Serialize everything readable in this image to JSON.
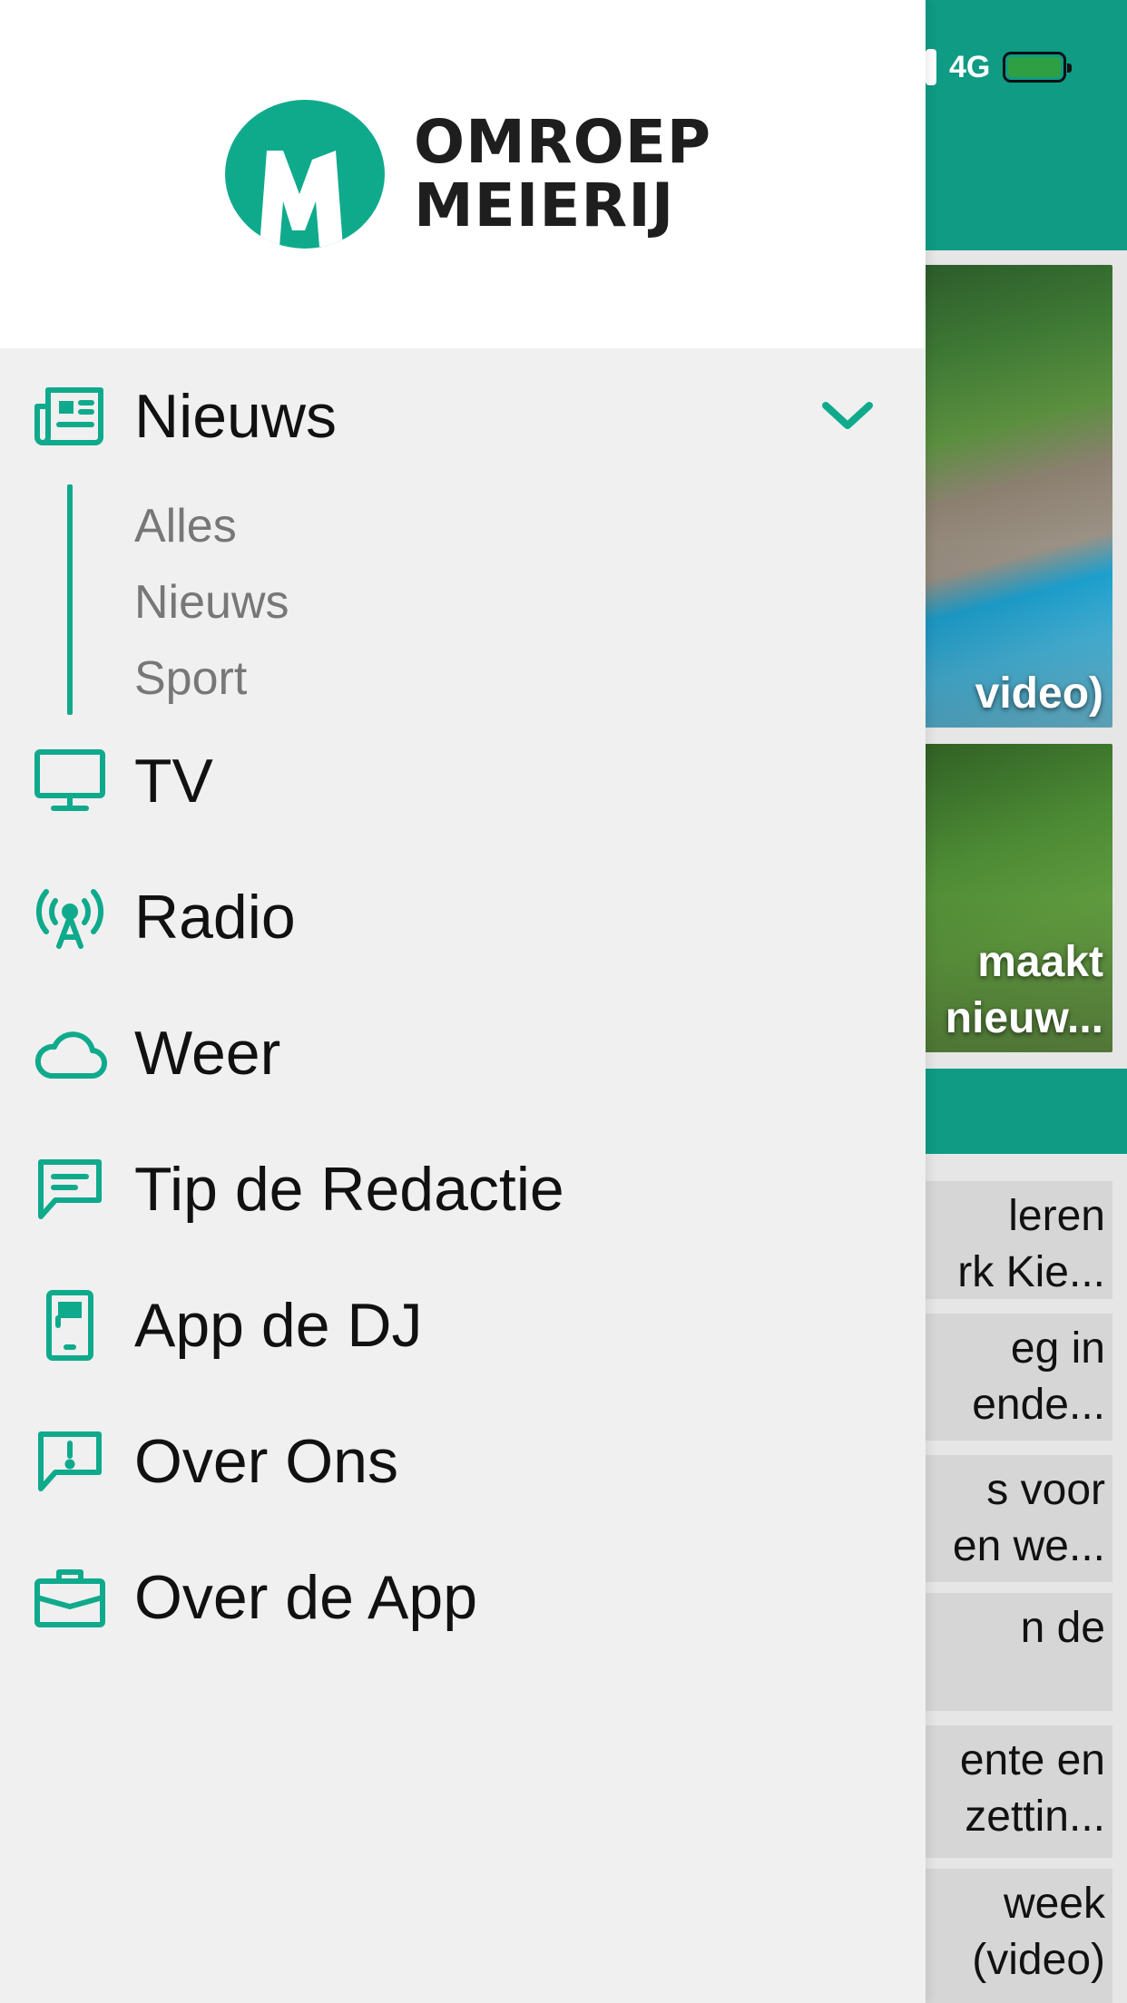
{
  "status_bar": {
    "network": "4G",
    "colors": {
      "battery": "#2ea043"
    }
  },
  "background": {
    "photo_captions": [
      "video)",
      "maakt",
      "nieuw..."
    ],
    "list_rows": [
      [
        "leren",
        "rk Kie..."
      ],
      [
        "eg in",
        "ende..."
      ],
      [
        "s voor",
        "en we..."
      ],
      [
        "n de",
        ""
      ],
      [
        "ente en",
        "zettin..."
      ],
      [
        "week",
        "(video)"
      ]
    ]
  },
  "drawer": {
    "logo": {
      "line1": "OMROEP",
      "line2": "MEIERIJ",
      "mark": "M"
    },
    "menu": {
      "nieuws": {
        "label": "Nieuws",
        "icon": "newspaper-icon",
        "expanded": true
      },
      "submenu": [
        "Alles",
        "Nieuws",
        "Sport"
      ],
      "tv": {
        "label": "TV",
        "icon": "monitor-icon"
      },
      "radio": {
        "label": "Radio",
        "icon": "broadcast-tower-icon"
      },
      "weer": {
        "label": "Weer",
        "icon": "cloud-icon"
      },
      "tip": {
        "label": "Tip de Redactie",
        "icon": "message-square-icon"
      },
      "appdj": {
        "label": "App de DJ",
        "icon": "phone-flag-icon"
      },
      "overons": {
        "label": "Over Ons",
        "icon": "message-alert-icon"
      },
      "overapp": {
        "label": "Over de App",
        "icon": "briefcase-icon"
      }
    }
  },
  "colors": {
    "accent": "#0faa8c",
    "header_green": "#0f9b84",
    "drawer_bg": "#f0f0f0",
    "text": "#111111",
    "sub_text": "#777777"
  }
}
